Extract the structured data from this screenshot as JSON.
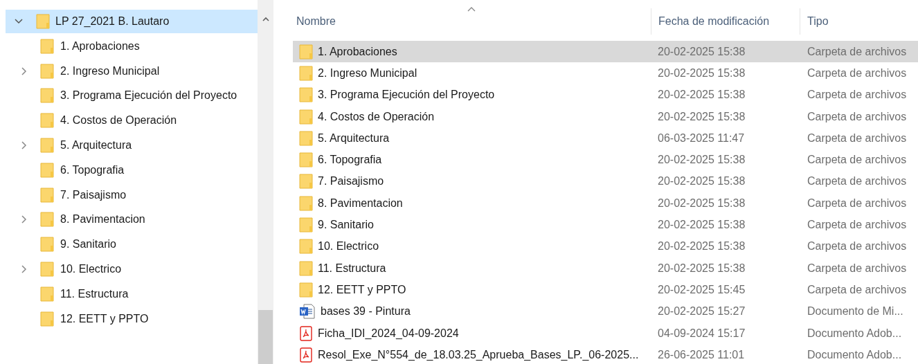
{
  "tree": {
    "label": "LP 27_2021 B. Lautaro",
    "expanded": true,
    "selected": true,
    "children": [
      {
        "label": "1. Aprobaciones",
        "expandable": false
      },
      {
        "label": "2. Ingreso Municipal",
        "expandable": true
      },
      {
        "label": "3. Programa Ejecución del Proyecto",
        "expandable": false
      },
      {
        "label": "4. Costos de Operación",
        "expandable": false
      },
      {
        "label": "5. Arquitectura",
        "expandable": true
      },
      {
        "label": "6. Topografia",
        "expandable": false
      },
      {
        "label": "7. Paisajismo",
        "expandable": false
      },
      {
        "label": "8. Pavimentacion",
        "expandable": true
      },
      {
        "label": "9. Sanitario",
        "expandable": false
      },
      {
        "label": "10. Electrico",
        "expandable": true
      },
      {
        "label": "11. Estructura",
        "expandable": false
      },
      {
        "label": "12. EETT y PPTO",
        "expandable": false
      }
    ]
  },
  "table": {
    "columns": [
      "Nombre",
      "Fecha de modificación",
      "Tipo"
    ],
    "rows": [
      {
        "kind": "folder",
        "name": "1. Aprobaciones",
        "date": "20-02-2025 15:38",
        "type": "Carpeta de archivos",
        "selected": true
      },
      {
        "kind": "folder",
        "name": "2. Ingreso Municipal",
        "date": "20-02-2025 15:38",
        "type": "Carpeta de archivos",
        "selected": false
      },
      {
        "kind": "folder",
        "name": "3. Programa Ejecución del Proyecto",
        "date": "20-02-2025 15:38",
        "type": "Carpeta de archivos",
        "selected": false
      },
      {
        "kind": "folder",
        "name": "4. Costos de Operación",
        "date": "20-02-2025 15:38",
        "type": "Carpeta de archivos",
        "selected": false
      },
      {
        "kind": "folder",
        "name": "5. Arquitectura",
        "date": "06-03-2025 11:47",
        "type": "Carpeta de archivos",
        "selected": false
      },
      {
        "kind": "folder",
        "name": "6. Topografia",
        "date": "20-02-2025 15:38",
        "type": "Carpeta de archivos",
        "selected": false
      },
      {
        "kind": "folder",
        "name": "7. Paisajismo",
        "date": "20-02-2025 15:38",
        "type": "Carpeta de archivos",
        "selected": false
      },
      {
        "kind": "folder",
        "name": "8. Pavimentacion",
        "date": "20-02-2025 15:38",
        "type": "Carpeta de archivos",
        "selected": false
      },
      {
        "kind": "folder",
        "name": "9. Sanitario",
        "date": "20-02-2025 15:38",
        "type": "Carpeta de archivos",
        "selected": false
      },
      {
        "kind": "folder",
        "name": "10. Electrico",
        "date": "20-02-2025 15:38",
        "type": "Carpeta de archivos",
        "selected": false
      },
      {
        "kind": "folder",
        "name": "11. Estructura",
        "date": "20-02-2025 15:38",
        "type": "Carpeta de archivos",
        "selected": false
      },
      {
        "kind": "folder",
        "name": "12. EETT y PPTO",
        "date": "20-02-2025 15:45",
        "type": "Carpeta de archivos",
        "selected": false
      },
      {
        "kind": "word",
        "name": "bases 39 - Pintura",
        "date": "20-02-2025 15:27",
        "type": "Documento de Mi...",
        "selected": false
      },
      {
        "kind": "pdf",
        "name": "Ficha_IDI_2024_04-09-2024",
        "date": "04-09-2024 15:17",
        "type": "Documento Adob...",
        "selected": false
      },
      {
        "kind": "pdf",
        "name": "Resol_Exe_N°554_de_18.03.25_Aprueba_Bases_LP._06-2025...",
        "date": "26-06-2025 11:01",
        "type": "Documento Adob...",
        "selected": false
      }
    ]
  }
}
